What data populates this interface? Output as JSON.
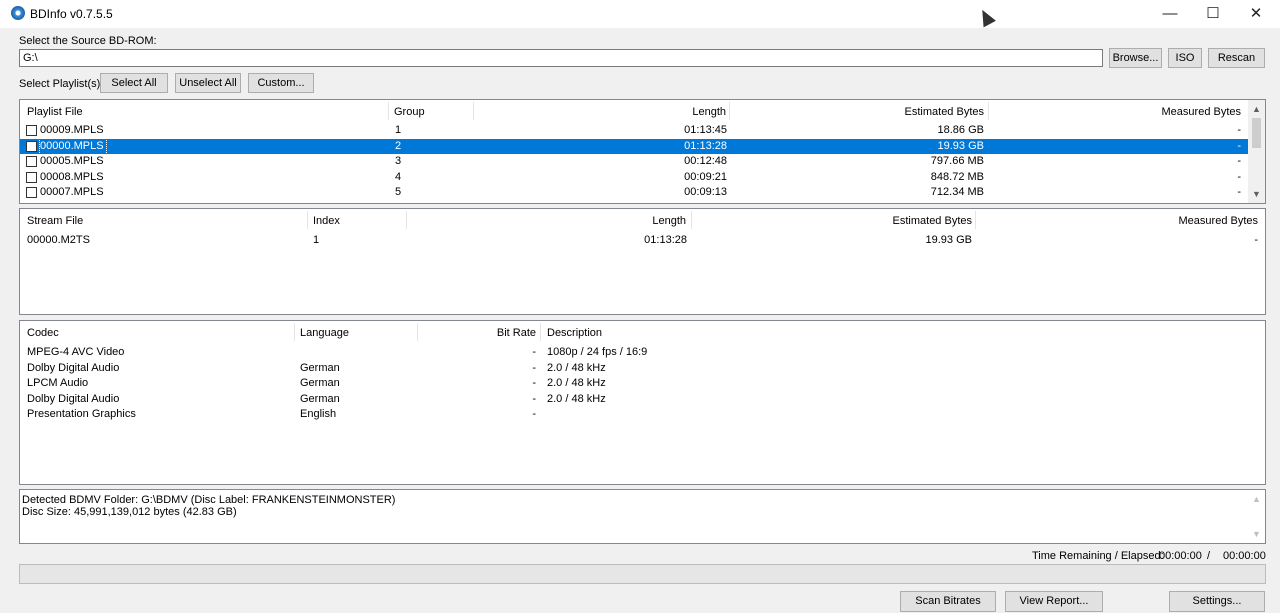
{
  "window": {
    "title": "BDInfo v0.7.5.5",
    "minimize_glyph": "—",
    "maximize_glyph": "☐",
    "close_glyph": "✕"
  },
  "source": {
    "label": "Select the Source BD-ROM:",
    "path": "G:\\",
    "browse_label": "Browse...",
    "iso_label": "ISO",
    "rescan_label": "Rescan"
  },
  "playlist_controls": {
    "label": "Select Playlist(s):",
    "select_all": "Select All",
    "unselect_all": "Unselect All",
    "custom": "Custom..."
  },
  "playlists": {
    "headers": [
      "Playlist File",
      "Group",
      "Length",
      "Estimated Bytes",
      "Measured Bytes"
    ],
    "rows": [
      {
        "file": "00009.MPLS",
        "group": "1",
        "length": "01:13:45",
        "est": "18.86 GB",
        "measured": "-",
        "selected": false
      },
      {
        "file": "00000.MPLS",
        "group": "2",
        "length": "01:13:28",
        "est": "19.93 GB",
        "measured": "-",
        "selected": true
      },
      {
        "file": "00005.MPLS",
        "group": "3",
        "length": "00:12:48",
        "est": "797.66 MB",
        "measured": "-",
        "selected": false
      },
      {
        "file": "00008.MPLS",
        "group": "4",
        "length": "00:09:21",
        "est": "848.72 MB",
        "measured": "-",
        "selected": false
      },
      {
        "file": "00007.MPLS",
        "group": "5",
        "length": "00:09:13",
        "est": "712.34 MB",
        "measured": "-",
        "selected": false
      }
    ]
  },
  "streams": {
    "headers": [
      "Stream File",
      "Index",
      "Length",
      "Estimated Bytes",
      "Measured Bytes"
    ],
    "rows": [
      {
        "file": "00000.M2TS",
        "index": "1",
        "length": "01:13:28",
        "est": "19.93 GB",
        "measured": "-"
      }
    ]
  },
  "codecs": {
    "headers": [
      "Codec",
      "Language",
      "Bit Rate",
      "Description"
    ],
    "rows": [
      {
        "codec": "MPEG-4 AVC Video",
        "language": "",
        "bitrate": "-",
        "description": "1080p / 24 fps / 16:9"
      },
      {
        "codec": "Dolby Digital Audio",
        "language": "German",
        "bitrate": "-",
        "description": "2.0 / 48 kHz"
      },
      {
        "codec": "LPCM Audio",
        "language": "German",
        "bitrate": "-",
        "description": "2.0 / 48 kHz"
      },
      {
        "codec": "Dolby Digital Audio",
        "language": "German",
        "bitrate": "-",
        "description": "2.0 / 48 kHz"
      },
      {
        "codec": "Presentation Graphics",
        "language": "English",
        "bitrate": "-",
        "description": ""
      }
    ]
  },
  "log": {
    "line1": "Detected BDMV Folder: G:\\BDMV (Disc Label: FRANKENSTEINMONSTER)",
    "line2": "Disc Size: 45,991,139,012 bytes (42.83 GB)"
  },
  "status": {
    "time_label": "Time Remaining / Elapsed:",
    "remaining": "00:00:00",
    "separator": "/",
    "elapsed": "00:00:00",
    "progress": 0
  },
  "actions": {
    "scan_bitrates": "Scan Bitrates",
    "view_report": "View Report...",
    "settings": "Settings..."
  },
  "colors": {
    "selection": "#0078d7",
    "window_bg": "#f0f0f0"
  }
}
